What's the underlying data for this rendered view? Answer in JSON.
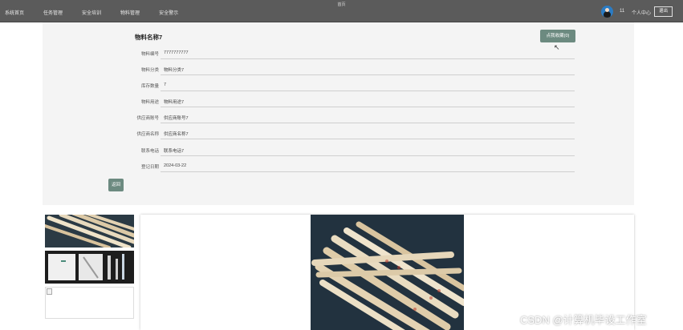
{
  "header": {
    "center_title": "首页",
    "nav": [
      "系统首页",
      "任务管理",
      "安全培训",
      "物料管理",
      "安全警示"
    ],
    "user_number": "11",
    "user_center": "个人中心",
    "logout": "退出"
  },
  "detail": {
    "title": "物料名称7",
    "favorite_button": "点我收藏(0)",
    "fields": [
      {
        "label": "物料编号",
        "value": "7777777777"
      },
      {
        "label": "物料分类",
        "value": "物料分类7"
      },
      {
        "label": "库存数量",
        "value": "7"
      },
      {
        "label": "物料用途",
        "value": "物料用途7"
      },
      {
        "label": "供应商账号",
        "value": "供应商账号7"
      },
      {
        "label": "供应商名称",
        "value": "供应商名称7"
      },
      {
        "label": "联系电话",
        "value": "联系电话7"
      },
      {
        "label": "登记日期",
        "value": "2024-03-22"
      }
    ],
    "back_button": "返回"
  },
  "gallery": {
    "thumbnails": [
      "chopsticks-packaged",
      "chopsticks-dark",
      "broken-image"
    ]
  },
  "watermark": "CSDN @计算机毕设工作室"
}
